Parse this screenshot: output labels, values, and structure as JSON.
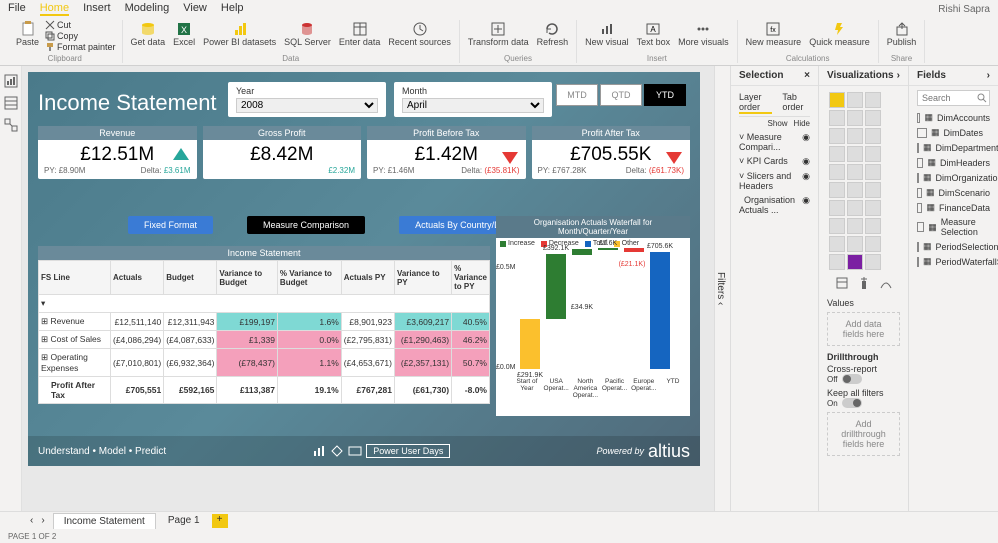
{
  "user": "Rishi Sapra",
  "menus": [
    "File",
    "Home",
    "Insert",
    "Modeling",
    "View",
    "Help"
  ],
  "active_menu": "Home",
  "ribbon": {
    "clipboard": {
      "label": "Clipboard",
      "paste": "Paste",
      "cut": "Cut",
      "copy": "Copy",
      "format": "Format painter"
    },
    "data": {
      "label": "Data",
      "get": "Get data",
      "excel": "Excel",
      "pbi": "Power BI datasets",
      "sql": "SQL Server",
      "enter": "Enter data",
      "recent": "Recent sources"
    },
    "queries": {
      "label": "Queries",
      "transform": "Transform data",
      "refresh": "Refresh"
    },
    "insert": {
      "label": "Insert",
      "visual": "New visual",
      "text": "Text box",
      "more": "More visuals"
    },
    "calc": {
      "label": "Calculations",
      "measure": "New measure",
      "quick": "Quick measure"
    },
    "share": {
      "label": "Share",
      "publish": "Publish"
    }
  },
  "report": {
    "title": "Income Statement",
    "year_label": "Year",
    "year_value": "2008",
    "month_label": "Month",
    "month_value": "April",
    "time": {
      "mtd": "MTD",
      "qtd": "QTD",
      "ytd": "YTD"
    },
    "kpis": [
      {
        "title": "Revenue",
        "value": "£12.51M",
        "py_label": "PY:",
        "py": "£8.90M",
        "delta_label": "Delta:",
        "delta": "£3.61M",
        "dir": "up"
      },
      {
        "title": "Gross Profit",
        "value": "£8.42M",
        "py_label": "",
        "py": "",
        "delta_label": "",
        "delta": "£2.32M",
        "dir": "none"
      },
      {
        "title": "Profit Before Tax",
        "value": "£1.42M",
        "py_label": "PY:",
        "py": "£1.46M",
        "delta_label": "Delta:",
        "delta": "(£35.81K)",
        "dir": "down"
      },
      {
        "title": "Profit After Tax",
        "value": "£705.55K",
        "py_label": "PY:",
        "py": "£767.28K",
        "delta_label": "Delta:",
        "delta": "(£61.73K)",
        "dir": "down"
      }
    ],
    "buttons": {
      "fixed": "Fixed Format",
      "compare": "Measure Comparison",
      "country": "Actuals By Country/Dept"
    },
    "table": {
      "title": "Income Statement",
      "cols": [
        "FS Line",
        "Actuals",
        "Budget",
        "Variance to Budget",
        "% Variance to Budget",
        "Actuals PY",
        "Variance to PY",
        "% Variance to PY"
      ],
      "rows": [
        [
          "Revenue",
          "£12,511,140",
          "£12,311,943",
          "£199,197",
          "1.6%",
          "£8,901,923",
          "£3,609,217",
          "40.5%"
        ],
        [
          "Cost of Sales",
          "(£4,086,294)",
          "(£4,087,633)",
          "£1,339",
          "0.0%",
          "(£2,795,831)",
          "(£1,290,463)",
          "46.2%"
        ],
        [
          "Operating Expenses",
          "(£7,010,801)",
          "(£6,932,364)",
          "(£78,437)",
          "1.1%",
          "(£4,653,671)",
          "(£2,357,131)",
          "50.7%"
        ],
        [
          "Profit After Tax",
          "£705,551",
          "£592,165",
          "£113,387",
          "19.1%",
          "£767,281",
          "(£61,730)",
          "-8.0%"
        ]
      ]
    },
    "waterfall": {
      "title": "Organisation Actuals Waterfall for Month/Quarter/Year"
    },
    "footer": {
      "tag": "Understand • Model • Predict",
      "badge": "Power User Days",
      "powered": "Powered by",
      "brand": "altius"
    }
  },
  "chart_data": {
    "type": "waterfall",
    "title": "Organisation Actuals Waterfall for Month/Quarter/Year",
    "legend": [
      "Increase",
      "Decrease",
      "Total",
      "Other"
    ],
    "colors": {
      "Increase": "#2e7d32",
      "Decrease": "#e53935",
      "Total": "#1565c0",
      "Other": "#fbc02d"
    },
    "yaxis": {
      "ticks": [
        "£0.0M",
        "£0.5M"
      ]
    },
    "series": [
      {
        "name": "Start of Year",
        "value": 291900,
        "label": "£291.9K",
        "type": "Other"
      },
      {
        "name": "USA Operat...",
        "value": 392100,
        "label": "£392.1K",
        "type": "Increase"
      },
      {
        "name": "North America Operat...",
        "value": 34900,
        "label": "£34.9K",
        "type": "Increase"
      },
      {
        "name": "Pacific Operat...",
        "value": 7600,
        "label": "£7.6K",
        "type": "Increase"
      },
      {
        "name": "Europe Operat...",
        "value": -21100,
        "label": "(£21.1K)",
        "type": "Decrease"
      },
      {
        "name": "YTD",
        "value": 705600,
        "label": "£705.6K",
        "type": "Total"
      }
    ]
  },
  "selection": {
    "title": "Selection",
    "layer": "Layer order",
    "tab": "Tab order",
    "show": "Show",
    "hide": "Hide",
    "items": [
      "Measure Compari...",
      "KPI Cards",
      "Slicers and Headers",
      "Organisation Actuals ..."
    ]
  },
  "viz": {
    "title": "Visualizations",
    "values": "Values",
    "add_fields": "Add data fields here",
    "drill": "Drillthrough",
    "cross": "Cross-report",
    "off": "Off",
    "keep": "Keep all filters",
    "on": "On",
    "add_drill": "Add drillthrough fields here"
  },
  "fields": {
    "title": "Fields",
    "search": "Search",
    "tables": [
      "DimAccounts",
      "DimDates",
      "DimDepartments",
      "DimHeaders",
      "DimOrganizations",
      "DimScenario",
      "FinanceData",
      "Measure Selection",
      "PeriodSelection",
      "PeriodWaterfallSele..."
    ]
  },
  "tabs": {
    "t1": "Income Statement",
    "t2": "Page 1"
  },
  "status": "PAGE 1 OF 2",
  "filters_label": "Filters"
}
